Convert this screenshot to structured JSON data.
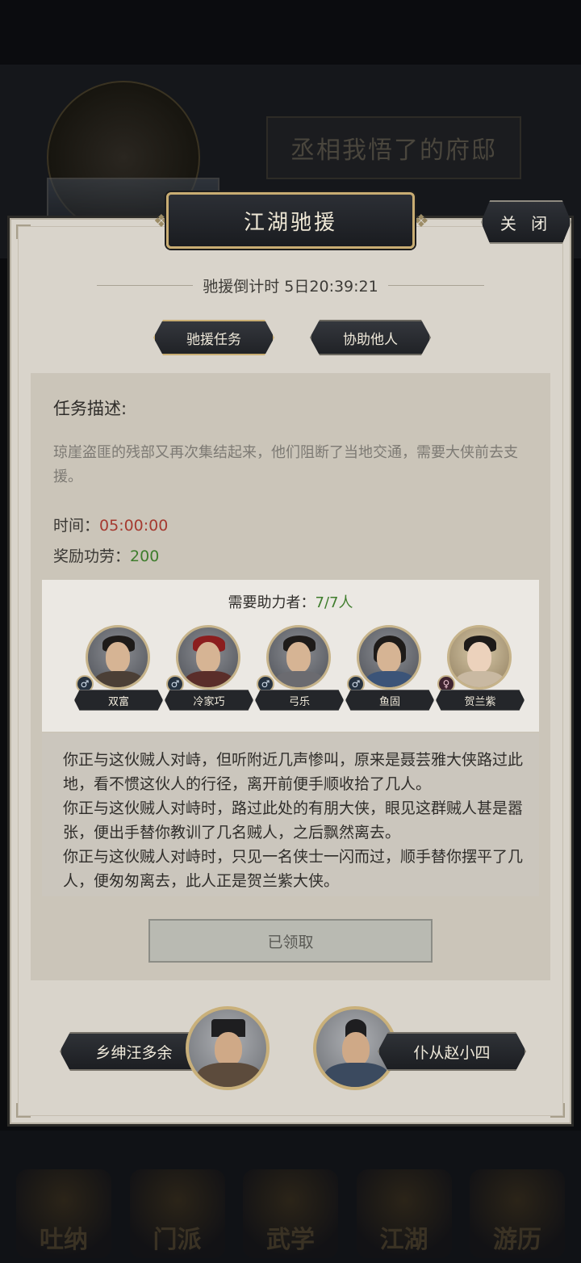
{
  "background": {
    "mansion_title": "丞相我悟了的府邸",
    "nav": [
      "吐纳",
      "门派",
      "武学",
      "江湖",
      "游历"
    ]
  },
  "dialog": {
    "title": "江湖驰援",
    "close_label": "关 闭",
    "countdown": "驰援倒计时 5日20:39:21",
    "tabs": [
      {
        "label": "驰援任务",
        "active": true
      },
      {
        "label": "协助他人",
        "active": false
      }
    ],
    "task": {
      "heading": "任务描述:",
      "description": "琼崖盗匪的残部又再次集结起来，他们阻断了当地交通，需要大侠前去支援。",
      "time_label": "时间：",
      "time_value": "05:00:00",
      "reward_label": "奖励功劳：",
      "reward_value": "200"
    },
    "helpers": {
      "label": "需要助力者：",
      "count": "7/7人",
      "list": [
        {
          "name": "双富",
          "gender": "♂"
        },
        {
          "name": "冷家巧",
          "gender": "♂"
        },
        {
          "name": "弓乐",
          "gender": "♂"
        },
        {
          "name": "鱼固",
          "gender": "♂"
        },
        {
          "name": "贺兰紫",
          "gender": "♀"
        }
      ]
    },
    "story": [
      "你正与这伙贼人对峙，但听附近几声惨叫，原来是聂芸雅大侠路过此地，看不惯这伙人的行径，离开前便手顺收拾了几人。",
      "你正与这伙贼人对峙时，路过此处的有朋大侠，眼见这群贼人甚是嚣张，便出手替你教训了几名贼人，之后飘然离去。",
      "你正与这伙贼人对峙时，只见一名侠士一闪而过，顺手替你摆平了几人，便匆匆离去，此人正是贺兰紫大侠。"
    ],
    "claimed_label": "已领取",
    "npcs": {
      "left": "乡绅汪多余",
      "right": "仆从赵小四"
    }
  },
  "colors": {
    "panel_bg": "#d9d4cb",
    "gold_border": "#c9ad73",
    "time_red": "#a53a30",
    "reward_green": "#3f7d2d"
  }
}
